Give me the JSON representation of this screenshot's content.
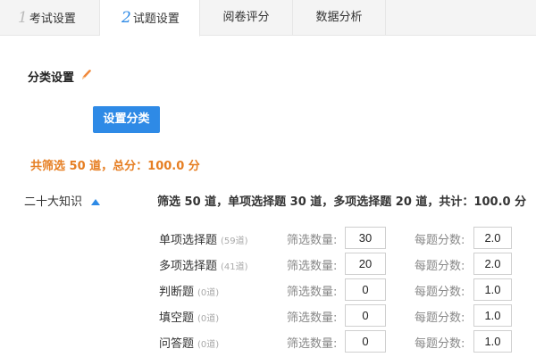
{
  "tabs": [
    {
      "num": "1",
      "label": "考试设置",
      "active": false
    },
    {
      "num": "2",
      "label": "试题设置",
      "active": true
    },
    {
      "num": "",
      "label": "阅卷评分",
      "active": false
    },
    {
      "num": "",
      "label": "数据分析",
      "active": false
    }
  ],
  "section": {
    "title": "分类设置",
    "edit_icon": "pencil-icon",
    "button_label": "设置分类"
  },
  "summary": "共筛选 50 道，总分：100.0 分",
  "knowledge": {
    "label": "二十大知识",
    "toggle_icon": "triangle-up-icon",
    "detail": "筛选 50 道，单项选择题 30 道，多项选择题 20 道，共计：100.0 分"
  },
  "labels": {
    "filter_count": "筛选数量:",
    "per_score": "每题分数:"
  },
  "question_types": [
    {
      "name": "单项选择题",
      "available": "(59道)",
      "filter_count": "30",
      "per_score": "2.0"
    },
    {
      "name": "多项选择题",
      "available": "(41道)",
      "filter_count": "20",
      "per_score": "2.0"
    },
    {
      "name": "判断题",
      "available": "(0道)",
      "filter_count": "0",
      "per_score": "1.0"
    },
    {
      "name": "填空题",
      "available": "(0道)",
      "filter_count": "0",
      "per_score": "1.0"
    },
    {
      "name": "问答题",
      "available": "(0道)",
      "filter_count": "0",
      "per_score": "1.0"
    }
  ],
  "colors": {
    "accent": "#2e8ae6",
    "summary": "#e67e22"
  }
}
